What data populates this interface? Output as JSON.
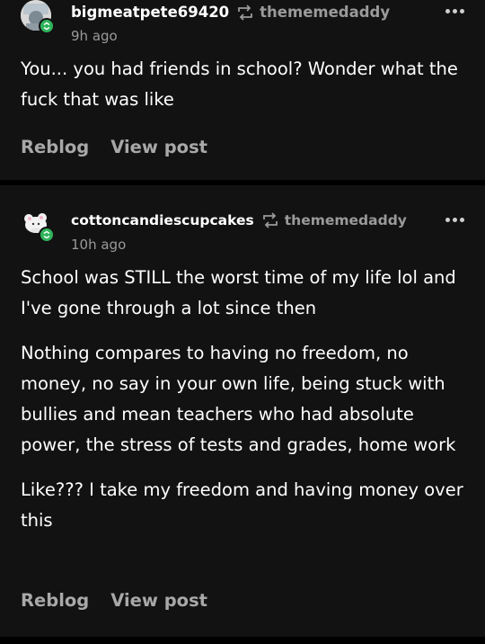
{
  "posts": [
    {
      "username": "bigmeatpete69420",
      "reblogged_from": "thememedaddy",
      "time": "9h ago",
      "paragraphs": [
        "You... you had friends in school? Wonder what the fuck that was like"
      ],
      "actions": {
        "reblog": "Reblog",
        "view": "View post"
      }
    },
    {
      "username": "cottoncandiescupcakes",
      "reblogged_from": "thememedaddy",
      "time": "10h ago",
      "paragraphs": [
        "School was STILL the worst time of my life lol and I've gone through a lot since then",
        "Nothing compares to having no freedom, no money, no say in your own life, being stuck with bullies and mean teachers who had absolute power, the stress of tests and grades, home work",
        "Like??? I take my freedom and having money over this"
      ],
      "actions": {
        "reblog": "Reblog",
        "view": "View post"
      }
    }
  ],
  "icons": {
    "reblog": "reblog-icon",
    "more": "more-options-icon",
    "badge": "checkmark-badge-icon"
  },
  "colors": {
    "background": "#000000",
    "card": "#121212",
    "badge_green": "#2fb35b",
    "muted": "#9a9a9a"
  }
}
